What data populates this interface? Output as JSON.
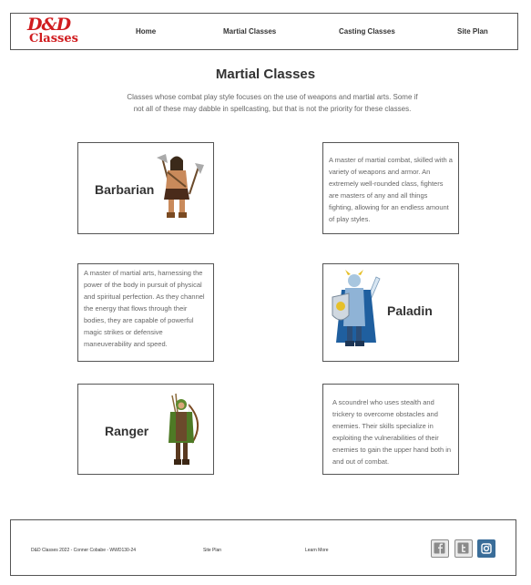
{
  "header": {
    "logo_top": "D&D",
    "logo_bottom": "Classes",
    "nav": [
      "Home",
      "Martial Classes",
      "Casting Classes",
      "Site Plan"
    ]
  },
  "page": {
    "title": "Martial Classes",
    "intro": "Classes whose combat play style focuses on the use of weapons and martial arts. Some if not all of these may dabble in spellcasting, but that is not the priority for these classes."
  },
  "classes": {
    "barbarian": {
      "name": "Barbarian",
      "desc": "A master of martial combat, skilled with a variety of weapons and armor. An extremely well-rounded class, fighters are masters of any and all things fighting, allowing for an endless amount of play styles."
    },
    "monk": {
      "desc": "A master of martial arts, harnessing the power of the body in pursuit of physical and spiritual perfection. As they channel the energy that flows through their bodies, they are capable of powerful magic strikes or defensive maneuverability and speed."
    },
    "paladin": {
      "name": "Paladin"
    },
    "ranger": {
      "name": "Ranger",
      "desc": "A scoundrel who uses stealth and trickery to overcome obstacles and enemies. Their skills specialize in exploiting the vulnerabilities of their enemies to gain the upper hand both in and out of combat."
    }
  },
  "footer": {
    "copyright": "D&D Classes 2022 - Conner Cobabe - WWD130-24",
    "site_plan": "Site Plan",
    "learn_more": "Learn More",
    "social": [
      "facebook-icon",
      "twitter-icon",
      "instagram-icon"
    ]
  },
  "colors": {
    "brand_red": "#d01c1f",
    "instagram_blue": "#3a6d99",
    "social_gray": "#8a8a8a"
  }
}
